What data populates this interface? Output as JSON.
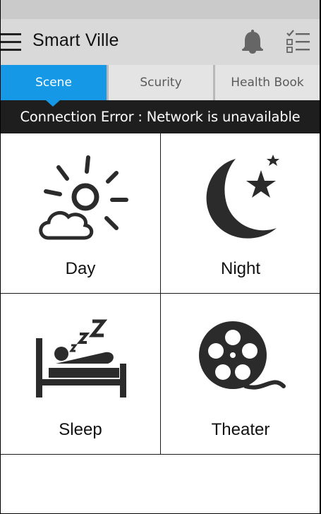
{
  "app": {
    "title": "Smart Ville"
  },
  "header": {
    "menu_icon": "hamburger-menu-icon",
    "notification_icon": "bell-icon",
    "checklist_icon": "checklist-icon"
  },
  "tabs": [
    {
      "label": "Scene",
      "active": true
    },
    {
      "label": "Scurity",
      "active": false
    },
    {
      "label": "Health Book",
      "active": false
    }
  ],
  "error": {
    "message": "Connection Error : Network is unavailable"
  },
  "scenes": [
    {
      "label": "Day",
      "icon": "sun-cloud-icon"
    },
    {
      "label": "Night",
      "icon": "moon-star-icon"
    },
    {
      "label": "Sleep",
      "icon": "bed-sleep-icon"
    },
    {
      "label": "Theater",
      "icon": "film-reel-icon"
    }
  ],
  "colors": {
    "accent": "#1598e6",
    "error_bar": "#1e1e1e",
    "app_bar": "#d9d9d9",
    "icon": "#2b2b2b"
  }
}
